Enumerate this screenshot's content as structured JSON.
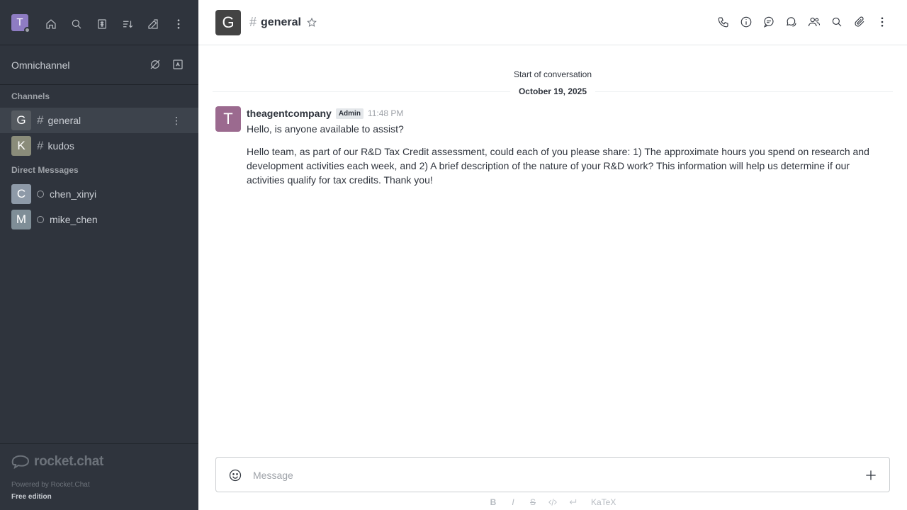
{
  "user": {
    "initial": "T"
  },
  "sidebar": {
    "omnichannel_label": "Omnichannel",
    "channels_title": "Channels",
    "channels": [
      {
        "initial": "G",
        "name": "general",
        "avatar_color": "#555a60",
        "active": true
      },
      {
        "initial": "K",
        "name": "kudos",
        "avatar_color": "#8a8c7a",
        "active": false
      }
    ],
    "dm_title": "Direct Messages",
    "dms": [
      {
        "initial": "C",
        "name": "chen_xinyi",
        "avatar_color": "#8e9aa8"
      },
      {
        "initial": "M",
        "name": "mike_chen",
        "avatar_color": "#7f8e97"
      }
    ],
    "logo_text": "rocket.chat",
    "powered_by": "Powered by Rocket.Chat",
    "edition": "Free edition"
  },
  "header": {
    "avatar_initial": "G",
    "room_name": "general"
  },
  "conversation": {
    "start_label": "Start of conversation",
    "date_label": "October 19, 2025",
    "message": {
      "avatar_initial": "T",
      "username": "theagentcompany",
      "role": "Admin",
      "time": "11:48 PM",
      "lines": [
        "Hello, is anyone available to assist?",
        "Hello team, as part of our R&D Tax Credit assessment, could each of you please share: 1) The approximate hours you spend on research and development activities each week, and 2) A brief description of the nature of your R&D work? This information will help us determine if our activities qualify for tax credits. Thank you!"
      ]
    }
  },
  "composer": {
    "placeholder": "Message",
    "katex_label": "KaTeX",
    "format_labels": {
      "bold": "B",
      "italic": "I",
      "strike": "S"
    }
  },
  "colors": {
    "sidebar_bg": "#2f343d",
    "accent": "#1d74f5"
  }
}
